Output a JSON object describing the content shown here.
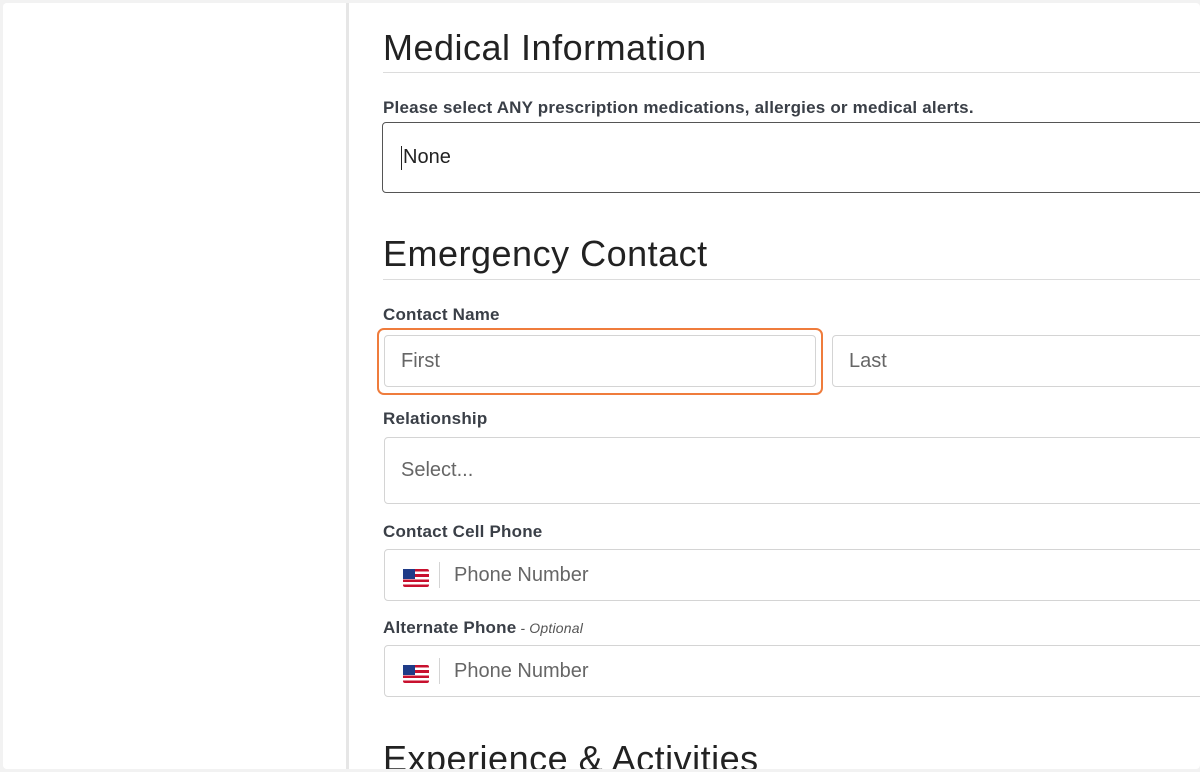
{
  "sections": {
    "medical": {
      "title": "Medical Information",
      "meds_label": "Please select ANY prescription medications, allergies or medical alerts.",
      "meds_value": "None"
    },
    "emergency": {
      "title": "Emergency Contact",
      "contact_name_label": "Contact Name",
      "first_placeholder": "First",
      "last_placeholder": "Last",
      "relationship_label": "Relationship",
      "relationship_placeholder": "Select...",
      "cell_phone_label": "Contact Cell Phone",
      "cell_phone_placeholder": "Phone Number",
      "alt_phone_label": "Alternate Phone",
      "alt_phone_optional": "- Optional",
      "alt_phone_placeholder": "Phone Number"
    },
    "experience": {
      "title": "Experience & Activities"
    }
  },
  "icons": {
    "phone_flag": "us-flag-icon"
  },
  "colors": {
    "focus": "#ef7c3c",
    "label": "#3a3f47"
  }
}
